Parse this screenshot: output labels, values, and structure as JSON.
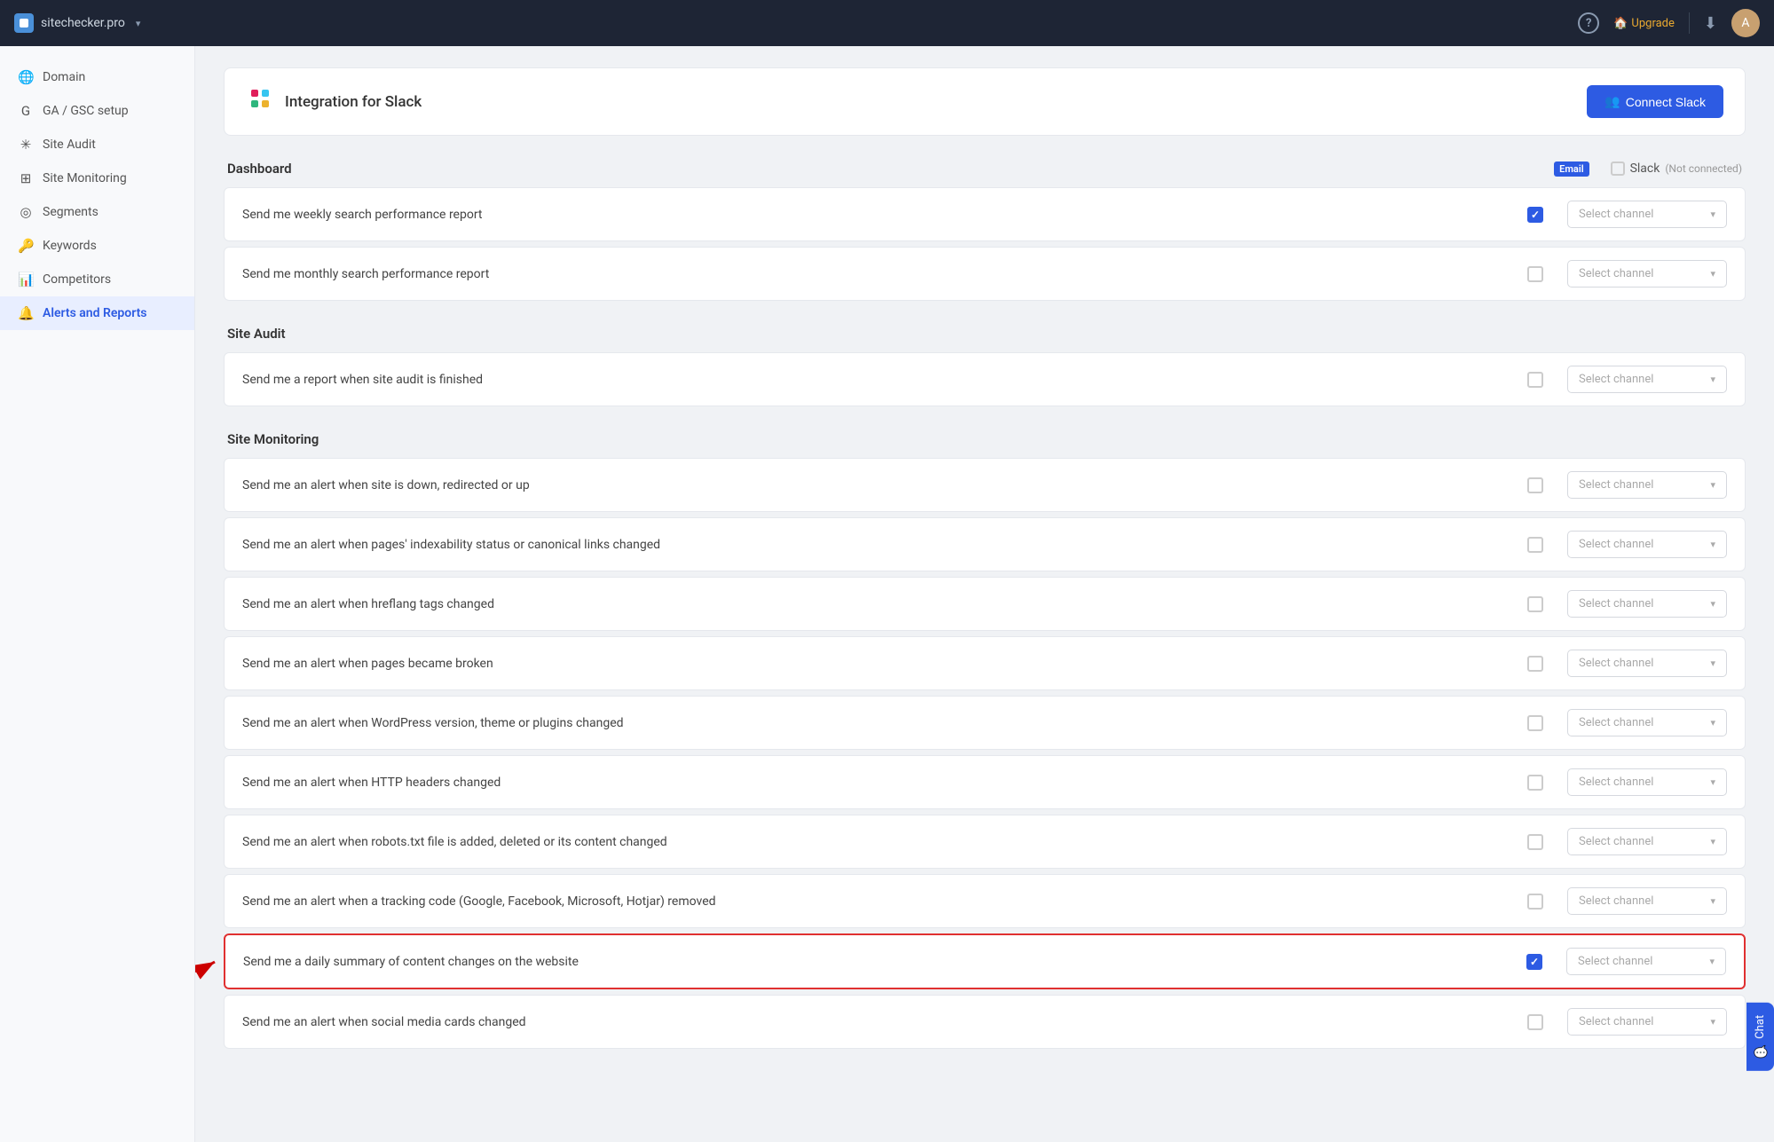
{
  "topnav": {
    "site": "sitechecker.pro",
    "chevron": "▾",
    "help_label": "?",
    "upgrade_label": "Upgrade",
    "download_icon": "⬇",
    "avatar_letter": "A"
  },
  "sidebar": {
    "items": [
      {
        "id": "domain",
        "label": "Domain",
        "icon": "🌐",
        "active": false
      },
      {
        "id": "ga-gsc",
        "label": "GA / GSC setup",
        "icon": "G",
        "active": false
      },
      {
        "id": "site-audit",
        "label": "Site Audit",
        "icon": "✳",
        "active": false
      },
      {
        "id": "site-monitoring",
        "label": "Site Monitoring",
        "icon": "⊞",
        "active": false
      },
      {
        "id": "segments",
        "label": "Segments",
        "icon": "◎",
        "active": false
      },
      {
        "id": "keywords",
        "label": "Keywords",
        "icon": "🔑",
        "active": false
      },
      {
        "id": "competitors",
        "label": "Competitors",
        "icon": "📊",
        "active": false
      },
      {
        "id": "alerts-reports",
        "label": "Alerts and Reports",
        "icon": "🔔",
        "active": true
      }
    ]
  },
  "integration": {
    "icon": "slack_hash",
    "title": "Integration for Slack",
    "connect_btn_label": "Connect Slack",
    "connect_btn_icon": "👥"
  },
  "email_header": "Email",
  "slack_header": "Slack",
  "not_connected": "(Not connected)",
  "select_channel_placeholder": "Select channel",
  "sections": [
    {
      "id": "dashboard",
      "title": "Dashboard",
      "rows": [
        {
          "id": "weekly-report",
          "text": "Send me weekly search performance report",
          "email_checked": true,
          "highlighted": false
        },
        {
          "id": "monthly-report",
          "text": "Send me monthly search performance report",
          "email_checked": false,
          "highlighted": false
        }
      ]
    },
    {
      "id": "site-audit",
      "title": "Site Audit",
      "rows": [
        {
          "id": "audit-finished",
          "text": "Send me a report when site audit is finished",
          "email_checked": false,
          "highlighted": false
        }
      ]
    },
    {
      "id": "site-monitoring",
      "title": "Site Monitoring",
      "rows": [
        {
          "id": "site-down",
          "text": "Send me an alert when site is down, redirected or up",
          "email_checked": false,
          "highlighted": false
        },
        {
          "id": "indexability",
          "text": "Send me an alert when pages' indexability status or canonical links changed",
          "email_checked": false,
          "highlighted": false
        },
        {
          "id": "hreflang",
          "text": "Send me an alert when hreflang tags changed",
          "email_checked": false,
          "highlighted": false
        },
        {
          "id": "broken-pages",
          "text": "Send me an alert when pages became broken",
          "email_checked": false,
          "highlighted": false
        },
        {
          "id": "wordpress",
          "text": "Send me an alert when WordPress version, theme or plugins changed",
          "email_checked": false,
          "highlighted": false
        },
        {
          "id": "http-headers",
          "text": "Send me an alert when HTTP headers changed",
          "email_checked": false,
          "highlighted": false
        },
        {
          "id": "robots-txt",
          "text": "Send me an alert when robots.txt file is added, deleted or its content changed",
          "email_checked": false,
          "highlighted": false
        },
        {
          "id": "tracking-code",
          "text": "Send me an alert when a tracking code (Google, Facebook, Microsoft, Hotjar) removed",
          "email_checked": false,
          "highlighted": false
        },
        {
          "id": "daily-summary",
          "text": "Send me a daily summary of content changes on the website",
          "email_checked": true,
          "highlighted": true
        },
        {
          "id": "social-media",
          "text": "Send me an alert when social media cards changed",
          "email_checked": false,
          "highlighted": false
        }
      ]
    }
  ],
  "chat_label": "Chat"
}
